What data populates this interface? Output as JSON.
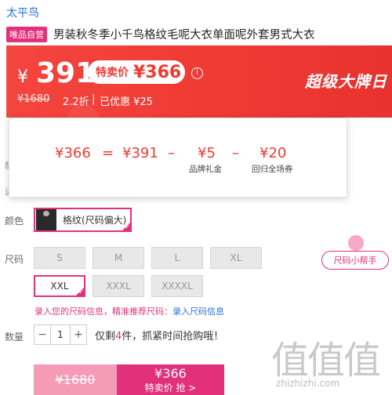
{
  "brand": "太平鸟",
  "product": {
    "badge": "唯品自营",
    "title": "男装秋冬季小千鸟格纹毛呢大衣单面呢外套男式大衣"
  },
  "banner": {
    "currency": "¥",
    "price": "391",
    "special_label": "特卖价",
    "special_price": "¥366",
    "info_icon": "info-icon",
    "original_price": "¥1680",
    "discount": "2.2折",
    "separator": "|",
    "saved": "已优惠 ¥25",
    "campaign": "超级大牌日",
    "colors": {
      "red": "#f03a34",
      "pink": "#e2317a"
    }
  },
  "calculation": {
    "total": "¥366",
    "eq": "=",
    "base": "¥391",
    "minus": "–",
    "coupon1": "¥5",
    "coupon1_label": "品牌礼金",
    "minus2": "–",
    "coupon2": "¥20",
    "coupon2_label": "回归全场券"
  },
  "left_cut": {
    "a": "配",
    "b": "运"
  },
  "color": {
    "label": "颜色",
    "option": "格纹(尺码偏大)"
  },
  "size": {
    "label": "尺码",
    "options": [
      "S",
      "M",
      "L",
      "XL",
      "XXL",
      "XXXL",
      "XXXXL"
    ],
    "selected": "XXL",
    "helper": "尺码小帮手"
  },
  "measure": {
    "prompt": "录入您的尺码信息，精准推荐尺码：",
    "link": "录入尺码信息"
  },
  "quantity": {
    "label": "数量",
    "minus": "−",
    "value": "1",
    "plus": "+",
    "stock_prefix": "仅剩",
    "stock_num": "4",
    "stock_suffix": "件，抓紧时间抢购哦！"
  },
  "buy": {
    "original": "¥1680",
    "price": "¥366",
    "label": "特卖价 抢 >"
  },
  "watermark": {
    "glyphs": "值值值",
    "url": "zhizhizhi.com"
  }
}
